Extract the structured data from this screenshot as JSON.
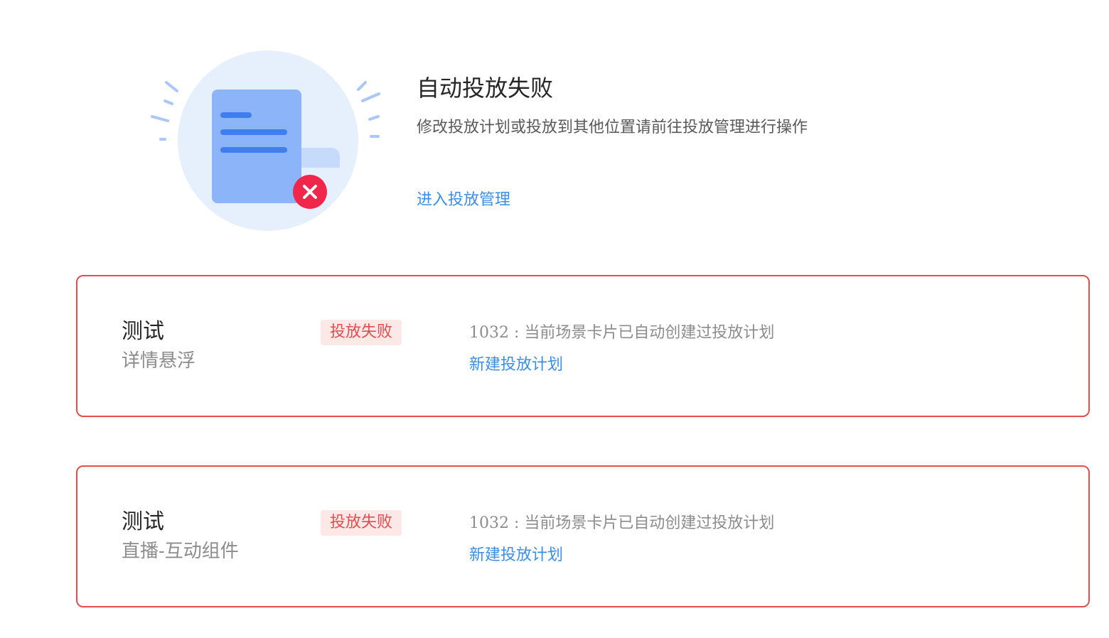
{
  "header": {
    "title": "自动投放失败",
    "subtitle": "修改投放计划或投放到其他位置请前往投放管理进行操作",
    "manage_link": "进入投放管理",
    "illustration_icon": "failed-document-icon"
  },
  "colors": {
    "accent_link": "#3a8ee6",
    "error": "#e34d4d",
    "error_bg": "#fde8e8",
    "illustration_circle": "#e6f0fd",
    "illustration_doc": "#8cb4f8",
    "illustration_lines": "#3f7ef0",
    "error_badge_icon": "#f0274b"
  },
  "cards": [
    {
      "name": "测试",
      "position": "详情悬浮",
      "status": "投放失败",
      "error_message": "1032 : 当前场景卡片已自动创建过投放计划",
      "action_link": "新建投放计划"
    },
    {
      "name": "测试",
      "position": "直播-互动组件",
      "status": "投放失败",
      "error_message": "1032 : 当前场景卡片已自动创建过投放计划",
      "action_link": "新建投放计划"
    }
  ]
}
